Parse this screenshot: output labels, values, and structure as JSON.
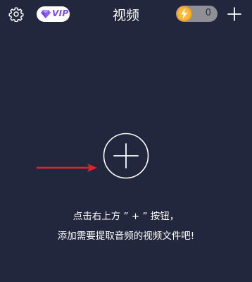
{
  "header": {
    "title": "视频",
    "vip_label": "VIP",
    "coin_count": "0"
  },
  "icons": {
    "settings": "gear-icon",
    "vip": "diamond-icon",
    "coin": "lightning-coin-icon",
    "add_top": "plus-icon",
    "add_center": "circle-plus-icon",
    "arrow": "red-arrow-icon"
  },
  "main": {
    "hint_line1": "点击右上方 ” + ” 按钮，",
    "hint_line2": "添加需要提取音频的视频文件吧!"
  },
  "colors": {
    "background": "#22273d",
    "vip_purple": "#7c4ae0",
    "coin_orange": "#f5a623",
    "arrow_red": "#d8262b"
  }
}
